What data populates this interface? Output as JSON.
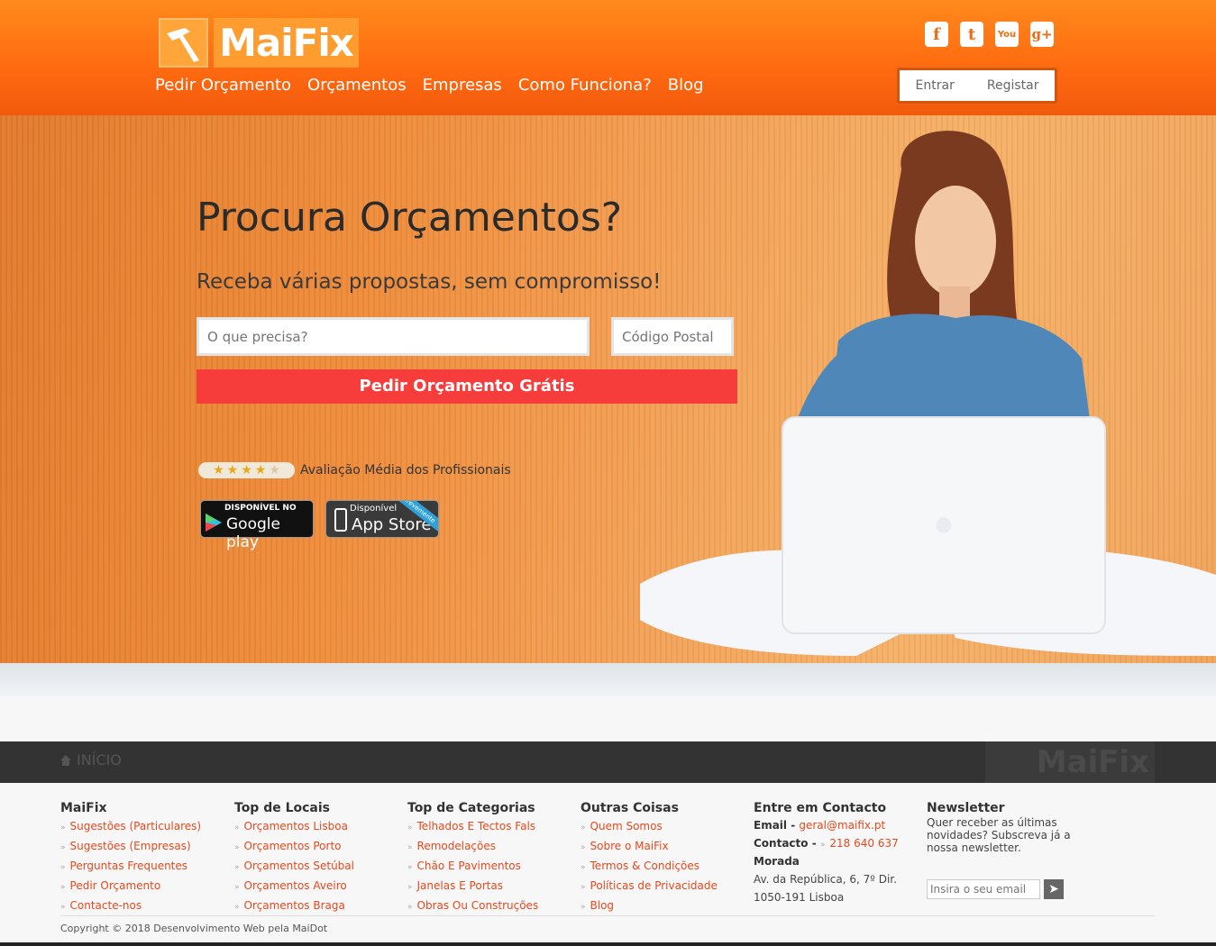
{
  "header": {
    "logo_text": "MaiFix",
    "nav": [
      "Pedir Orçamento",
      "Orçamentos",
      "Empresas",
      "Como Funciona?",
      "Blog"
    ],
    "social": [
      {
        "icon": "facebook-icon",
        "glyph": "f"
      },
      {
        "icon": "twitter-icon",
        "glyph": "t"
      },
      {
        "icon": "youtube-icon",
        "glyph": "You"
      },
      {
        "icon": "googleplus-icon",
        "glyph": "g+"
      }
    ],
    "login": "Entrar",
    "register": "Registar"
  },
  "hero": {
    "title": "Procura Orçamentos?",
    "subtitle": "Receba várias propostas, sem compromisso!",
    "what_placeholder": "O que precisa?",
    "postal_placeholder": "Código Postal",
    "cta": "Pedir Orçamento Grátis",
    "rating_label": "Avaliação Média dos Profissionais",
    "rating_stars": 4.5,
    "gplay_small": "DISPONÍVEL NO",
    "gplay_big": "Google play",
    "appstore_small": "Disponível",
    "appstore_big": "App Store",
    "appstore_ribbon": "Brevemente"
  },
  "breadcrumb": {
    "home": "INÍCIO",
    "watermark": "MaiFix"
  },
  "footer": {
    "col1": {
      "title": "MaiFix",
      "items": [
        "Sugestões (Particulares)",
        "Sugestões (Empresas)",
        "Perguntas Frequentes",
        "Pedir Orçamento",
        "Contacte-nos"
      ]
    },
    "col2": {
      "title": "Top de Locais",
      "items": [
        "Orçamentos Lisboa",
        "Orçamentos Porto",
        "Orçamentos Setúbal",
        "Orçamentos Aveiro",
        "Orçamentos Braga"
      ]
    },
    "col3": {
      "title": "Top de Categorias",
      "items": [
        "Telhados E Tectos Fals",
        "Remodelações",
        "Chão E Pavimentos",
        "Janelas E Portas",
        "Obras Ou Construções"
      ]
    },
    "col4": {
      "title": "Outras Coisas",
      "items": [
        "Quem Somos",
        "Sobre o MaiFix",
        "Termos & Condições",
        "Políticas de Privacidade",
        "Blog"
      ]
    },
    "contact": {
      "title": "Entre em Contacto",
      "email_label": "Email - ",
      "email": "geral@maifix.pt",
      "phone_label": "Contacto - ",
      "phone": "218 640 637",
      "address_label": "Morada",
      "address1": "Av. da República, 6, 7º Dir.",
      "address2": "1050-191 Lisboa"
    },
    "newsletter": {
      "title": "Newsletter",
      "text": "Quer receber as últimas novidades? Subscreva já a nossa newsletter.",
      "placeholder": "Insira o seu email"
    },
    "copyright": "Copyright © 2018 Desenvolvimento Web pela MaiDot"
  }
}
